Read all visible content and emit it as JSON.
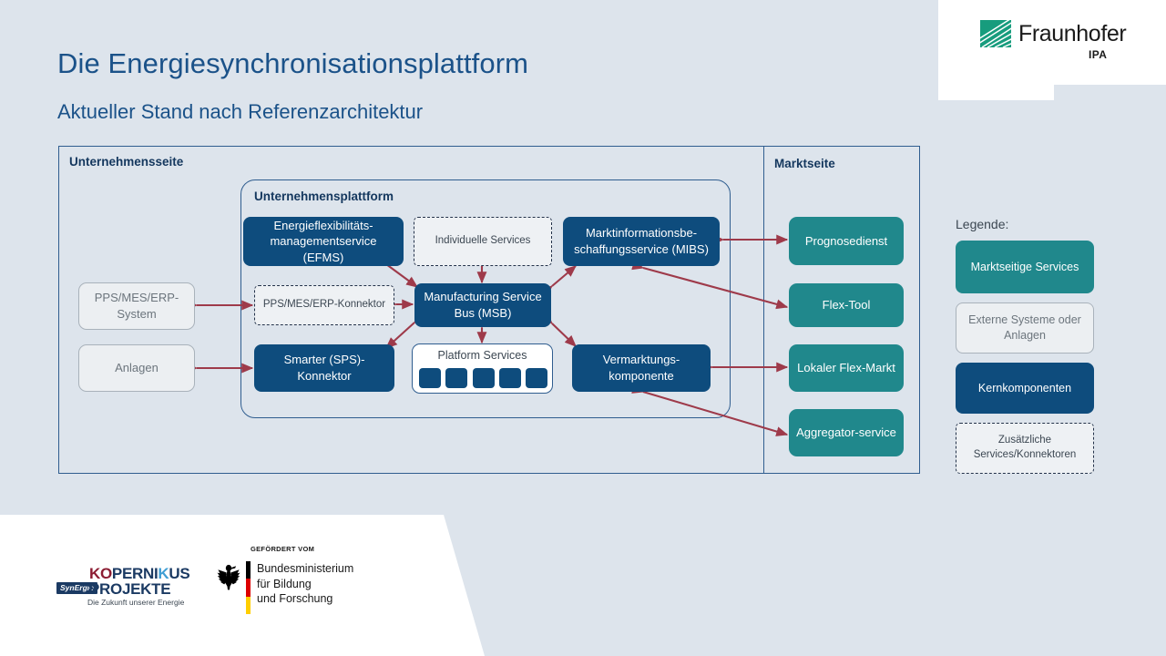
{
  "header": {
    "title": "Die Energiesynchronisationsplattform",
    "subtitle": "Aktueller Stand nach Referenzarchitektur",
    "logo": {
      "wordmark": "Fraunhofer",
      "institute": "IPA"
    }
  },
  "diagram": {
    "enterprise_label": "Unternehmensseite",
    "market_label": "Marktseite",
    "platform_label": "Unternehmensplattform",
    "external_nodes": [
      {
        "label": "PPS/MES/ERP-System"
      },
      {
        "label": "Anlagen"
      }
    ],
    "connector_nodes": [
      {
        "label": "PPS/MES/ERP-Konnektor"
      },
      {
        "label": "Individuelle Services"
      }
    ],
    "core_nodes": [
      {
        "label": "Energieflexibilitäts-managementservice (EFMS)"
      },
      {
        "label": "Marktinformationsbe-schaffungsservice (MIBS)"
      },
      {
        "label": "Manufacturing Service Bus (MSB)"
      },
      {
        "label": "Smarter (SPS)-Konnektor"
      },
      {
        "label": "Vermarktungs-komponente"
      }
    ],
    "platform_services": {
      "label": "Platform Services",
      "tile_count": 5
    },
    "market_nodes": [
      {
        "label": "Prognosedienst"
      },
      {
        "label": "Flex-Tool"
      },
      {
        "label": "Lokaler Flex-Markt"
      },
      {
        "label": "Aggregator-service"
      }
    ]
  },
  "legend": {
    "title": "Legende:",
    "items": [
      {
        "label": "Marktseitige Services",
        "color": "#20888c"
      },
      {
        "label": "Externe Systeme oder Anlagen",
        "color": "#eceff2"
      },
      {
        "label": "Kernkomponenten",
        "color": "#0e4c7d"
      },
      {
        "label": "Zusätzliche Services/Konnektoren",
        "color": "#eef1f4"
      }
    ]
  },
  "footer": {
    "kopernikus": {
      "line1": "KOPERNIKUS",
      "line2": "PROJEKTE",
      "badge": "SynErgie",
      "tagline": "Die Zukunft unserer Energie"
    },
    "bmbf": {
      "funded_by": "GEFÖRDERT VOM",
      "ministry_line1": "Bundesministerium",
      "ministry_line2": "für Bildung",
      "ministry_line3": "und Forschung"
    }
  },
  "colors": {
    "background": "#dde4ec",
    "accent_blue": "#0e4c7d",
    "title_blue": "#1b5289",
    "teal": "#20888c",
    "arrow_red": "#9e3a4a",
    "fraunhofer_green": "#179c7d"
  }
}
